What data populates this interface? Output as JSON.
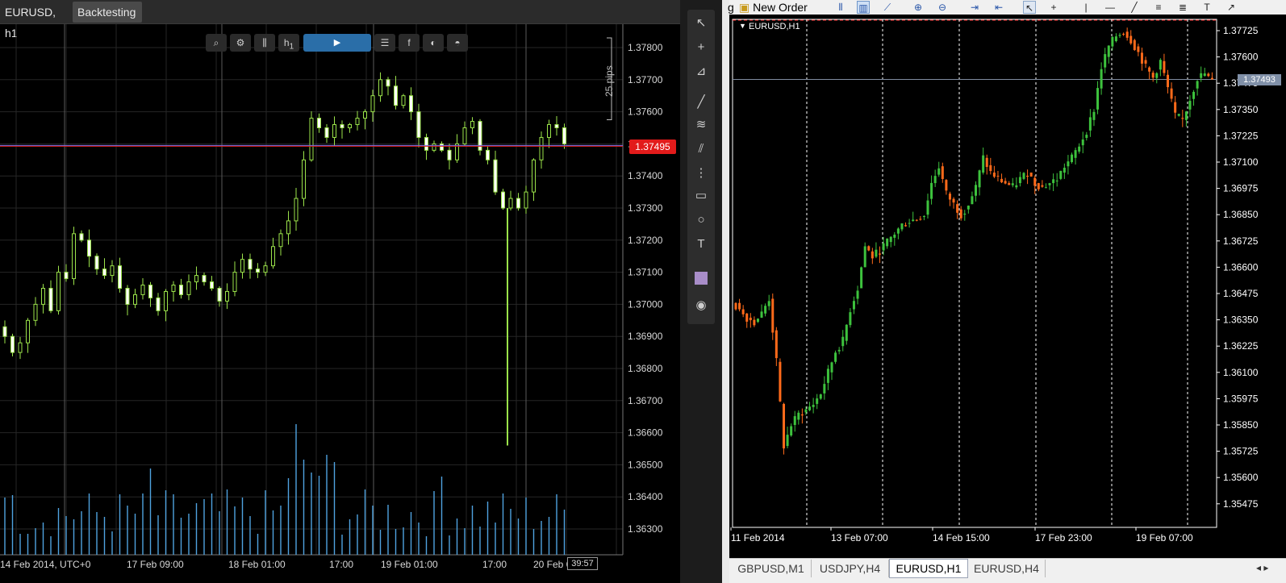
{
  "left": {
    "tabs": [
      {
        "label": "EURUSD, h1"
      },
      {
        "label": "Backtesting"
      }
    ],
    "toolbar": {
      "buttons": [
        "zoom-icon",
        "chart-settings-icon",
        "candles-icon",
        "timeframe-icon",
        "play-icon",
        "list-icon",
        "facebook-icon",
        "share-icon",
        "incognito-icon"
      ],
      "timeframe_label": "h",
      "timeframe_sub": "1",
      "play_glyph": "▶"
    },
    "price_axis": [
      "1.37800",
      "1.37700",
      "1.37600",
      "1.37500",
      "1.37400",
      "1.37300",
      "1.37200",
      "1.37100",
      "1.37000",
      "1.36900",
      "1.36800",
      "1.36700",
      "1.36600",
      "1.36500",
      "1.36400",
      "1.36300"
    ],
    "current_price": "1.37495",
    "pips_label": "25 pips",
    "time_axis": [
      "14 Feb 2014, UTC+0",
      "17 Feb 09:00",
      "18 Feb 01:00",
      "17:00",
      "19 Feb 01:00",
      "17:00",
      "20 Feb 01:00"
    ],
    "countdown": "39:57",
    "colors": {
      "bull": "#9be34a",
      "bear": "#ffffff",
      "volume": "#4fa3e0",
      "price_tag": "#e21b1b",
      "grid": "#262626"
    }
  },
  "tools": [
    {
      "name": "pointer",
      "glyph": "↖"
    },
    {
      "name": "crosshair",
      "glyph": "+"
    },
    {
      "name": "measure",
      "glyph": "⊿"
    },
    {
      "name": "trendline",
      "glyph": "╱"
    },
    {
      "name": "fibonacci",
      "glyph": "≋"
    },
    {
      "name": "channel",
      "glyph": "⫽"
    },
    {
      "name": "fib-grid",
      "glyph": "⋮"
    },
    {
      "name": "rectangle",
      "glyph": "▭"
    },
    {
      "name": "ellipse",
      "glyph": "○"
    },
    {
      "name": "text",
      "glyph": "T"
    },
    {
      "name": "snapshot",
      "glyph": "◉"
    }
  ],
  "right": {
    "toolbar": {
      "cut_text": "g",
      "new_order": "New Order"
    },
    "chart_title": "EURUSD,H1",
    "price_axis": [
      "1.37725",
      "1.37600",
      "1.37475",
      "1.37350",
      "1.37225",
      "1.37100",
      "1.36975",
      "1.36850",
      "1.36725",
      "1.36600",
      "1.36475",
      "1.36350",
      "1.36225",
      "1.36100",
      "1.35975",
      "1.35850",
      "1.35725",
      "1.35600",
      "1.35475"
    ],
    "current_price": "1.37493",
    "time_axis": [
      "11 Feb 2014",
      "13 Feb 07:00",
      "14 Feb 15:00",
      "17 Feb 23:00",
      "19 Feb 07:00"
    ],
    "tabs": [
      {
        "label": "GBPUSD,M1"
      },
      {
        "label": "USDJPY,H4"
      },
      {
        "label": "EURUSD,H1"
      },
      {
        "label": "EURUSD,H4"
      }
    ],
    "tabs_more": "◂ ▸",
    "colors": {
      "bull": "#3dc23d",
      "bear": "#ff6a1a",
      "axis": "#ffffff",
      "separator": "#ffffff"
    }
  }
}
